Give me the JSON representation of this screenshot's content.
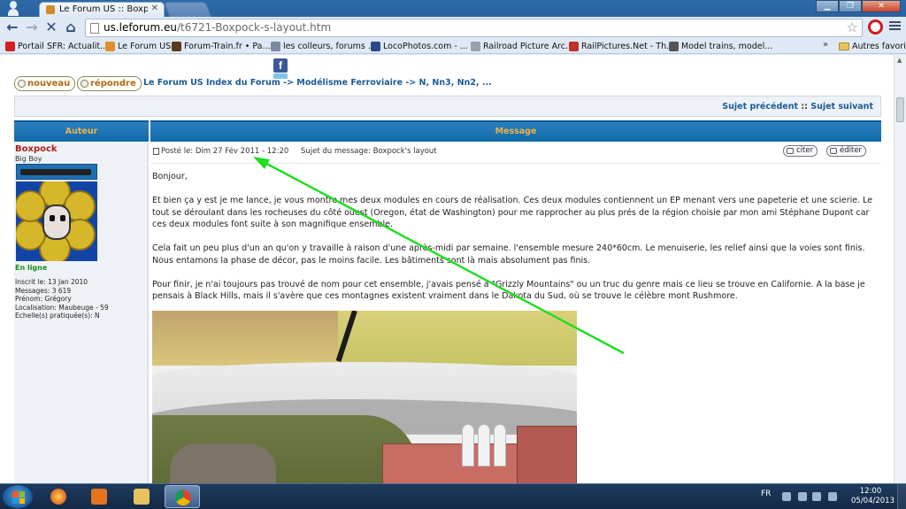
{
  "browser": {
    "tab_title": "Le Forum US :: Boxpock's",
    "url_host": "us.leforum.eu",
    "url_path": "/t6721-Boxpock-s-layout.htm"
  },
  "bookmarks": [
    {
      "label": "Portail SFR: Actualit...",
      "color": "#d62020"
    },
    {
      "label": "Le Forum US",
      "color": "#e0902a"
    },
    {
      "label": "Forum-Train.fr • Pa...",
      "color": "#5a3a1a"
    },
    {
      "label": "les colleurs, forums ...",
      "color": "#7a8aa0"
    },
    {
      "label": "LocoPhotos.com - ...",
      "color": "#2a4a8a"
    },
    {
      "label": "Railroad Picture Arc...",
      "color": "#9aa0a8"
    },
    {
      "label": "RailPictures.Net - Th...",
      "color": "#c0302a"
    },
    {
      "label": "Model trains, model...",
      "color": "#555555"
    }
  ],
  "bookmarks_more": "»",
  "bookmarks_others": "Autres favoris",
  "forum": {
    "btn_new": "nouveau",
    "btn_reply": "répondre",
    "breadcrumb": "Le Forum US Index du Forum -> Modélisme Ferroviaire -> N, Nn3, Nn2, ...",
    "prev_topic": "Sujet précédent",
    "link_sep": "::",
    "next_topic": "Sujet suivant",
    "col_author": "Auteur",
    "col_message": "Message"
  },
  "author": {
    "name": "Boxpock",
    "rank": "Big Boy",
    "status": "En ligne",
    "info": [
      "Inscrit le: 13 Jan 2010",
      "Messages: 3 619",
      "Prénom: Grégory",
      "Localisation: Maubeuge - 59",
      "Echelle(s) pratiquée(s): N"
    ]
  },
  "post": {
    "date": "Posté le: Dim 27 Fév 2011 - 12:20",
    "subject": "Sujet du message: Boxpock's layout",
    "btn_quote": "citer",
    "btn_edit": "éditer",
    "paragraphs": [
      "Bonjour,",
      "Et bien ça y est je me lance, je vous montre mes deux modules en cours de réalisation. Ces deux modules contiennent un EP menant vers une papeterie et une scierie. Le tout se déroulant dans les rocheuses du côté ouest (Oregon, état de Washington) pour me rapprocher au plus prés de la région choisie par mon ami Stéphane Dupont car ces deux modules font suite à son magnifique ensemble.",
      "Cela fait un peu plus d'un an qu'on y travaille à raison d'une après-midi par semaine. l'ensemble mesure 240*60cm. Le menuiserie, les relief ainsi que la voies sont finis. Nous entamons la phase de décor, pas le moins facile. Les bâtiments sont là mais absolument pas finis.",
      "Pour finir, je n'ai toujours pas trouvé de nom pour cet ensemble, j'avais pensé à \"Grizzly Mountains\" ou un truc du genre mais ce lieu se trouve en Californie. A la base je pensais à Black Hills, mais il s'avère que ces montagnes existent vraiment dans le Dakota du Sud, où se trouve le célèbre mont Rushmore."
    ]
  },
  "taskbar": {
    "lang": "FR",
    "time": "12:00",
    "date": "05/04/2013"
  },
  "colors": {
    "annotation_arrow": "#22dd22",
    "header_blue": "#1f74b5",
    "author_red": "#b01d1d"
  }
}
